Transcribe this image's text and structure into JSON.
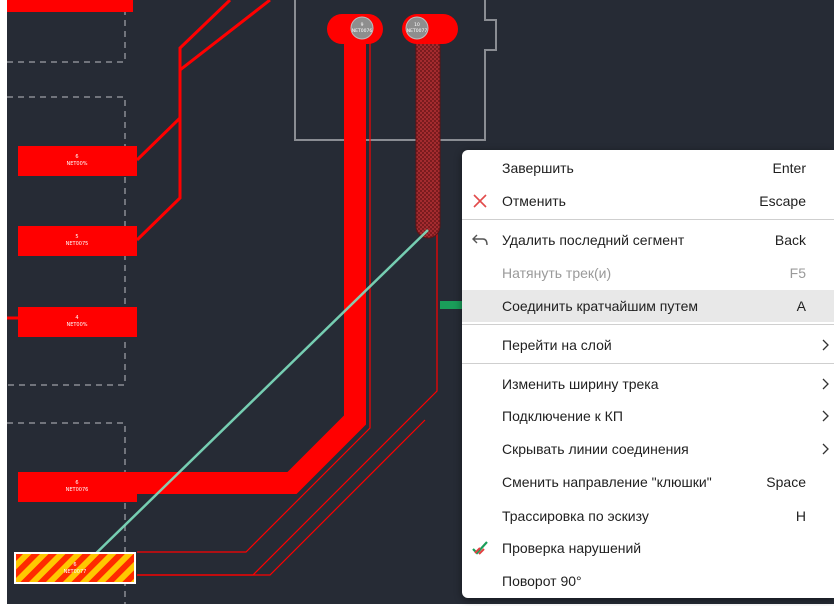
{
  "board": {
    "pads": [
      {
        "number": "6",
        "net": "NET00%"
      },
      {
        "number": "5",
        "net": "NET0075"
      },
      {
        "number": "4",
        "net": "NET00%"
      },
      {
        "number": "6",
        "net": "NET0076"
      },
      {
        "number": "6",
        "net": "NET0077"
      }
    ],
    "vias": [
      {
        "number": "9",
        "net": "NET0076"
      },
      {
        "number": "10",
        "net": "NET0077"
      }
    ],
    "colors": {
      "background": "#262b35",
      "copper": "#ff0000",
      "ratsnest": "#7fe0c0",
      "outline": "#8a8d93",
      "highlight_stripe": "#ffcc00"
    }
  },
  "context_menu": {
    "items": [
      {
        "label": "Завершить",
        "shortcut": "Enter",
        "icon": ""
      },
      {
        "label": "Отменить",
        "shortcut": "Escape",
        "icon": "close-x-icon"
      },
      {
        "label": "Удалить последний сегмент",
        "shortcut": "Back",
        "icon": "undo-arrow-icon"
      },
      {
        "label": "Натянуть трек(и)",
        "shortcut": "F5",
        "icon": "",
        "disabled": true
      },
      {
        "label": "Соединить кратчайшим путем",
        "shortcut": "A",
        "icon": "",
        "highlighted": true
      },
      {
        "label": "Перейти на слой",
        "shortcut": "",
        "submenu": true
      },
      {
        "label": "Изменить ширину трека",
        "shortcut": "",
        "submenu": true
      },
      {
        "label": "Подключение к КП",
        "shortcut": "",
        "submenu": true
      },
      {
        "label": "Скрывать линии соединения",
        "shortcut": "",
        "submenu": true
      },
      {
        "label": "Сменить направление \"клюшки\"",
        "shortcut": "Space"
      },
      {
        "label": "Трассировка по эскизу",
        "shortcut": "H"
      },
      {
        "label": "Проверка нарушений",
        "shortcut": "",
        "icon": "drc-check-icon"
      },
      {
        "label": "Поворот 90°",
        "shortcut": ""
      }
    ],
    "pointer_icon": "green-arrow-icon",
    "pointer_color": "#1a9e5a"
  }
}
